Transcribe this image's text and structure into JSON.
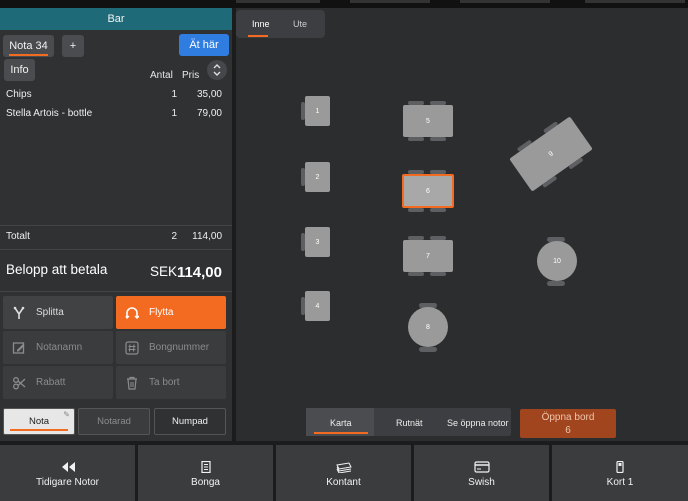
{
  "header": {
    "title": "Bar"
  },
  "note_controls": {
    "note_tab": "Nota 34",
    "add_label": "+",
    "eat_here": "Ät här"
  },
  "info_label": "Info",
  "columns": {
    "qty": "Antal",
    "price": "Pris"
  },
  "items": [
    {
      "name": "Chips",
      "qty": "1",
      "price": "35,00"
    },
    {
      "name": "Stella Artois - bottle",
      "qty": "1",
      "price": "79,00"
    }
  ],
  "total": {
    "label": "Totalt",
    "qty": "2",
    "amount": "114,00"
  },
  "payment": {
    "label": "Belopp att betala",
    "currency": "SEK",
    "amount": "114,00"
  },
  "actions": [
    {
      "label": "Splitta",
      "icon": "split-icon"
    },
    {
      "label": "Flytta",
      "icon": "move-icon"
    },
    {
      "label": "Notanamn",
      "icon": "edit-icon"
    },
    {
      "label": "Bongnummer",
      "icon": "hash-icon"
    },
    {
      "label": "Rabatt",
      "icon": "discount-icon"
    },
    {
      "label": "Ta bort",
      "icon": "trash-icon"
    }
  ],
  "bottom_tabs": {
    "nota": "Nota",
    "notarad": "Notarad",
    "numpad": "Numpad"
  },
  "area_tabs": {
    "inside": "Inne",
    "outside": "Ute"
  },
  "tables": [
    "1",
    "2",
    "3",
    "4",
    "5",
    "6",
    "7",
    "8",
    "9",
    "10"
  ],
  "view_switch": {
    "map": "Karta",
    "grid": "Rutnät",
    "open_notes": "Se öppna notor"
  },
  "open_table": {
    "label": "Öppna bord",
    "number": "6"
  },
  "footer": [
    {
      "label": "Tidigare Notor",
      "icon": "rewind-icon"
    },
    {
      "label": "Bonga",
      "icon": "receipt-icon"
    },
    {
      "label": "Kontant",
      "icon": "cash-icon"
    },
    {
      "label": "Swish",
      "icon": "swish-icon"
    },
    {
      "label": "Kort 1",
      "icon": "card-terminal-icon"
    }
  ],
  "colors": {
    "accent": "#f36a21",
    "header": "#1f6a78",
    "primary": "#2f7de0"
  }
}
